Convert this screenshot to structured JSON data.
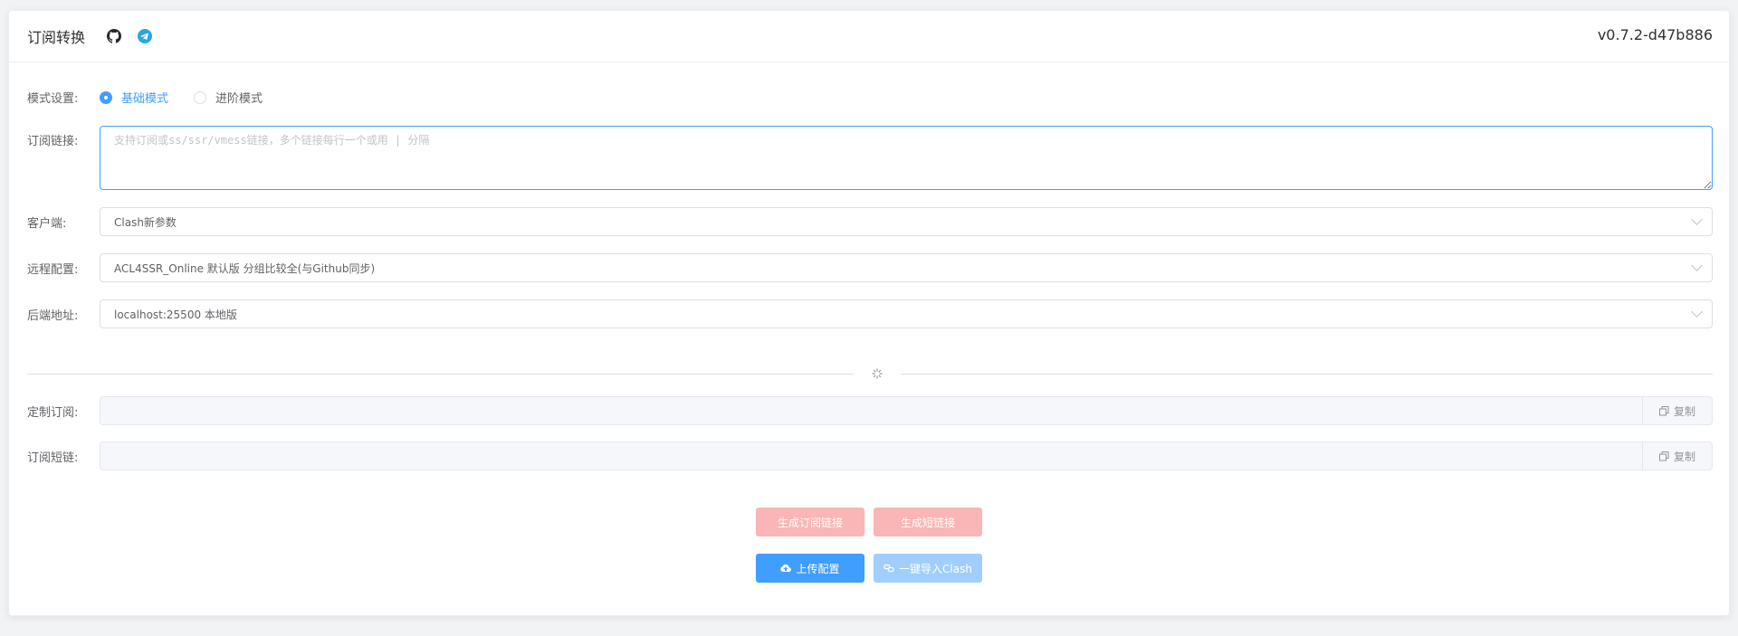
{
  "header": {
    "title": "订阅转换",
    "version": "v0.7.2-d47b886",
    "icons": [
      "github-icon",
      "telegram-icon"
    ]
  },
  "form": {
    "mode": {
      "label": "模式设置:",
      "options": [
        {
          "label": "基础模式",
          "checked": true
        },
        {
          "label": "进阶模式",
          "checked": false
        }
      ]
    },
    "subscription": {
      "label": "订阅链接:",
      "value": "",
      "placeholder": "支持订阅或ss/ssr/vmess链接，多个链接每行一个或用 | 分隔"
    },
    "client": {
      "label": "客户端:",
      "value": "Clash新参数"
    },
    "remote_config": {
      "label": "远程配置:",
      "value": "ACL4SSR_Online 默认版 分组比较全(与Github同步)"
    },
    "backend": {
      "label": "后端地址:",
      "value": "localhost:25500 本地版"
    }
  },
  "output": {
    "custom_sub": {
      "label": "定制订阅:",
      "value": "",
      "copy_label": "复制"
    },
    "short_link": {
      "label": "订阅短链:",
      "value": "",
      "copy_label": "复制"
    }
  },
  "actions": {
    "generate_sub": "生成订阅链接",
    "generate_short": "生成短链接",
    "upload_config": "上传配置",
    "import_clash": "一键导入Clash"
  },
  "colors": {
    "primary": "#409eff",
    "danger_disabled": "#fab6b6",
    "primary_disabled": "#a0cfff"
  }
}
